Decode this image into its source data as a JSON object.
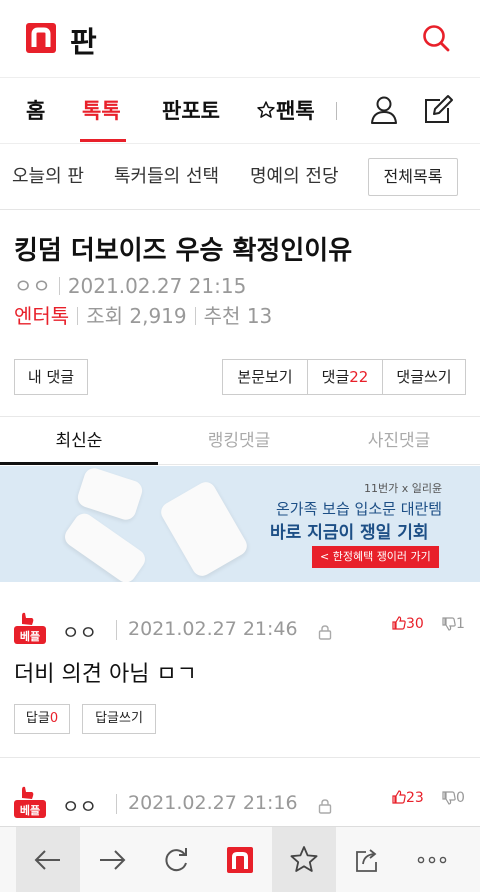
{
  "header": {
    "logo_text": "판",
    "brand_color": "#e8202a"
  },
  "nav": {
    "items": [
      {
        "label": "홈"
      },
      {
        "label": "톡톡"
      },
      {
        "label": "판포토"
      },
      {
        "label": "팬톡"
      }
    ],
    "active": "톡톡"
  },
  "subnav": {
    "items": [
      "오늘의 판",
      "톡커들의 선택",
      "명예의 전당"
    ],
    "all_button": "전체목록"
  },
  "post": {
    "title": "킹덤 더보이즈 우승 확정인이유",
    "author": "ㅇㅇ",
    "datetime": "2021.02.27 21:15",
    "category": "엔터톡",
    "views_label": "조회",
    "views": "2,919",
    "recommend_label": "추천",
    "recommend": "13"
  },
  "actions": {
    "my_comments": "내 댓글",
    "view_post": "본문보기",
    "comments_label": "댓글",
    "comments_count": "22",
    "write_comment": "댓글쓰기"
  },
  "tabs": [
    {
      "label": "최신순",
      "active": true
    },
    {
      "label": "랭킹댓글",
      "active": false
    },
    {
      "label": "사진댓글",
      "active": false
    }
  ],
  "ad": {
    "brand": "11번가 x 일리윤",
    "line1": "온가족 보습 입소문 대란템",
    "line2": "바로 지금이 쟁일 기회",
    "cta": "< 한정혜택 쟁이러 가기"
  },
  "comments": [
    {
      "badge": "베플",
      "author": "ㅇㅇ",
      "datetime": "2021.02.27 21:46",
      "likes": "30",
      "dislikes": "1",
      "text": "더비 의견 아님 ㅁㄱ",
      "reply_label": "답글",
      "reply_count": "0",
      "write_reply": "답글쓰기"
    },
    {
      "badge": "베플",
      "author": "ㅇㅇ",
      "datetime": "2021.02.27 21:16",
      "likes": "23",
      "dislikes": "0"
    }
  ],
  "bottombar": {
    "icons": [
      "back-arrow-icon",
      "forward-arrow-icon",
      "refresh-icon",
      "nate-logo-icon",
      "star-icon",
      "share-icon",
      "more-icon"
    ]
  }
}
